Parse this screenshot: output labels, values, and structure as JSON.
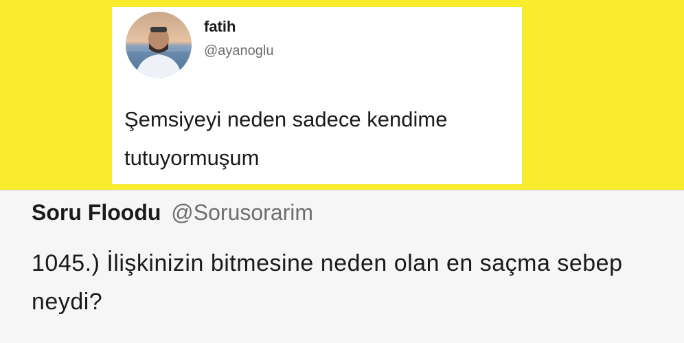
{
  "reply_tweet": {
    "display_name": "fatih",
    "handle": "@ayanoglu",
    "text": "Şemsiyeyi neden sadece kendime tutuyormuşum"
  },
  "question_tweet": {
    "display_name": "Soru Floodu",
    "handle": "@Sorusorarim",
    "text": "1045.) İlişkinizin bitmesine neden olan en saçma sebep neydi?"
  },
  "colors": {
    "background_accent": "#f8ec2d",
    "text_primary": "#1a1a1a",
    "text_secondary": "#6e6e6e"
  },
  "icons": [
    "avatar-photo"
  ]
}
